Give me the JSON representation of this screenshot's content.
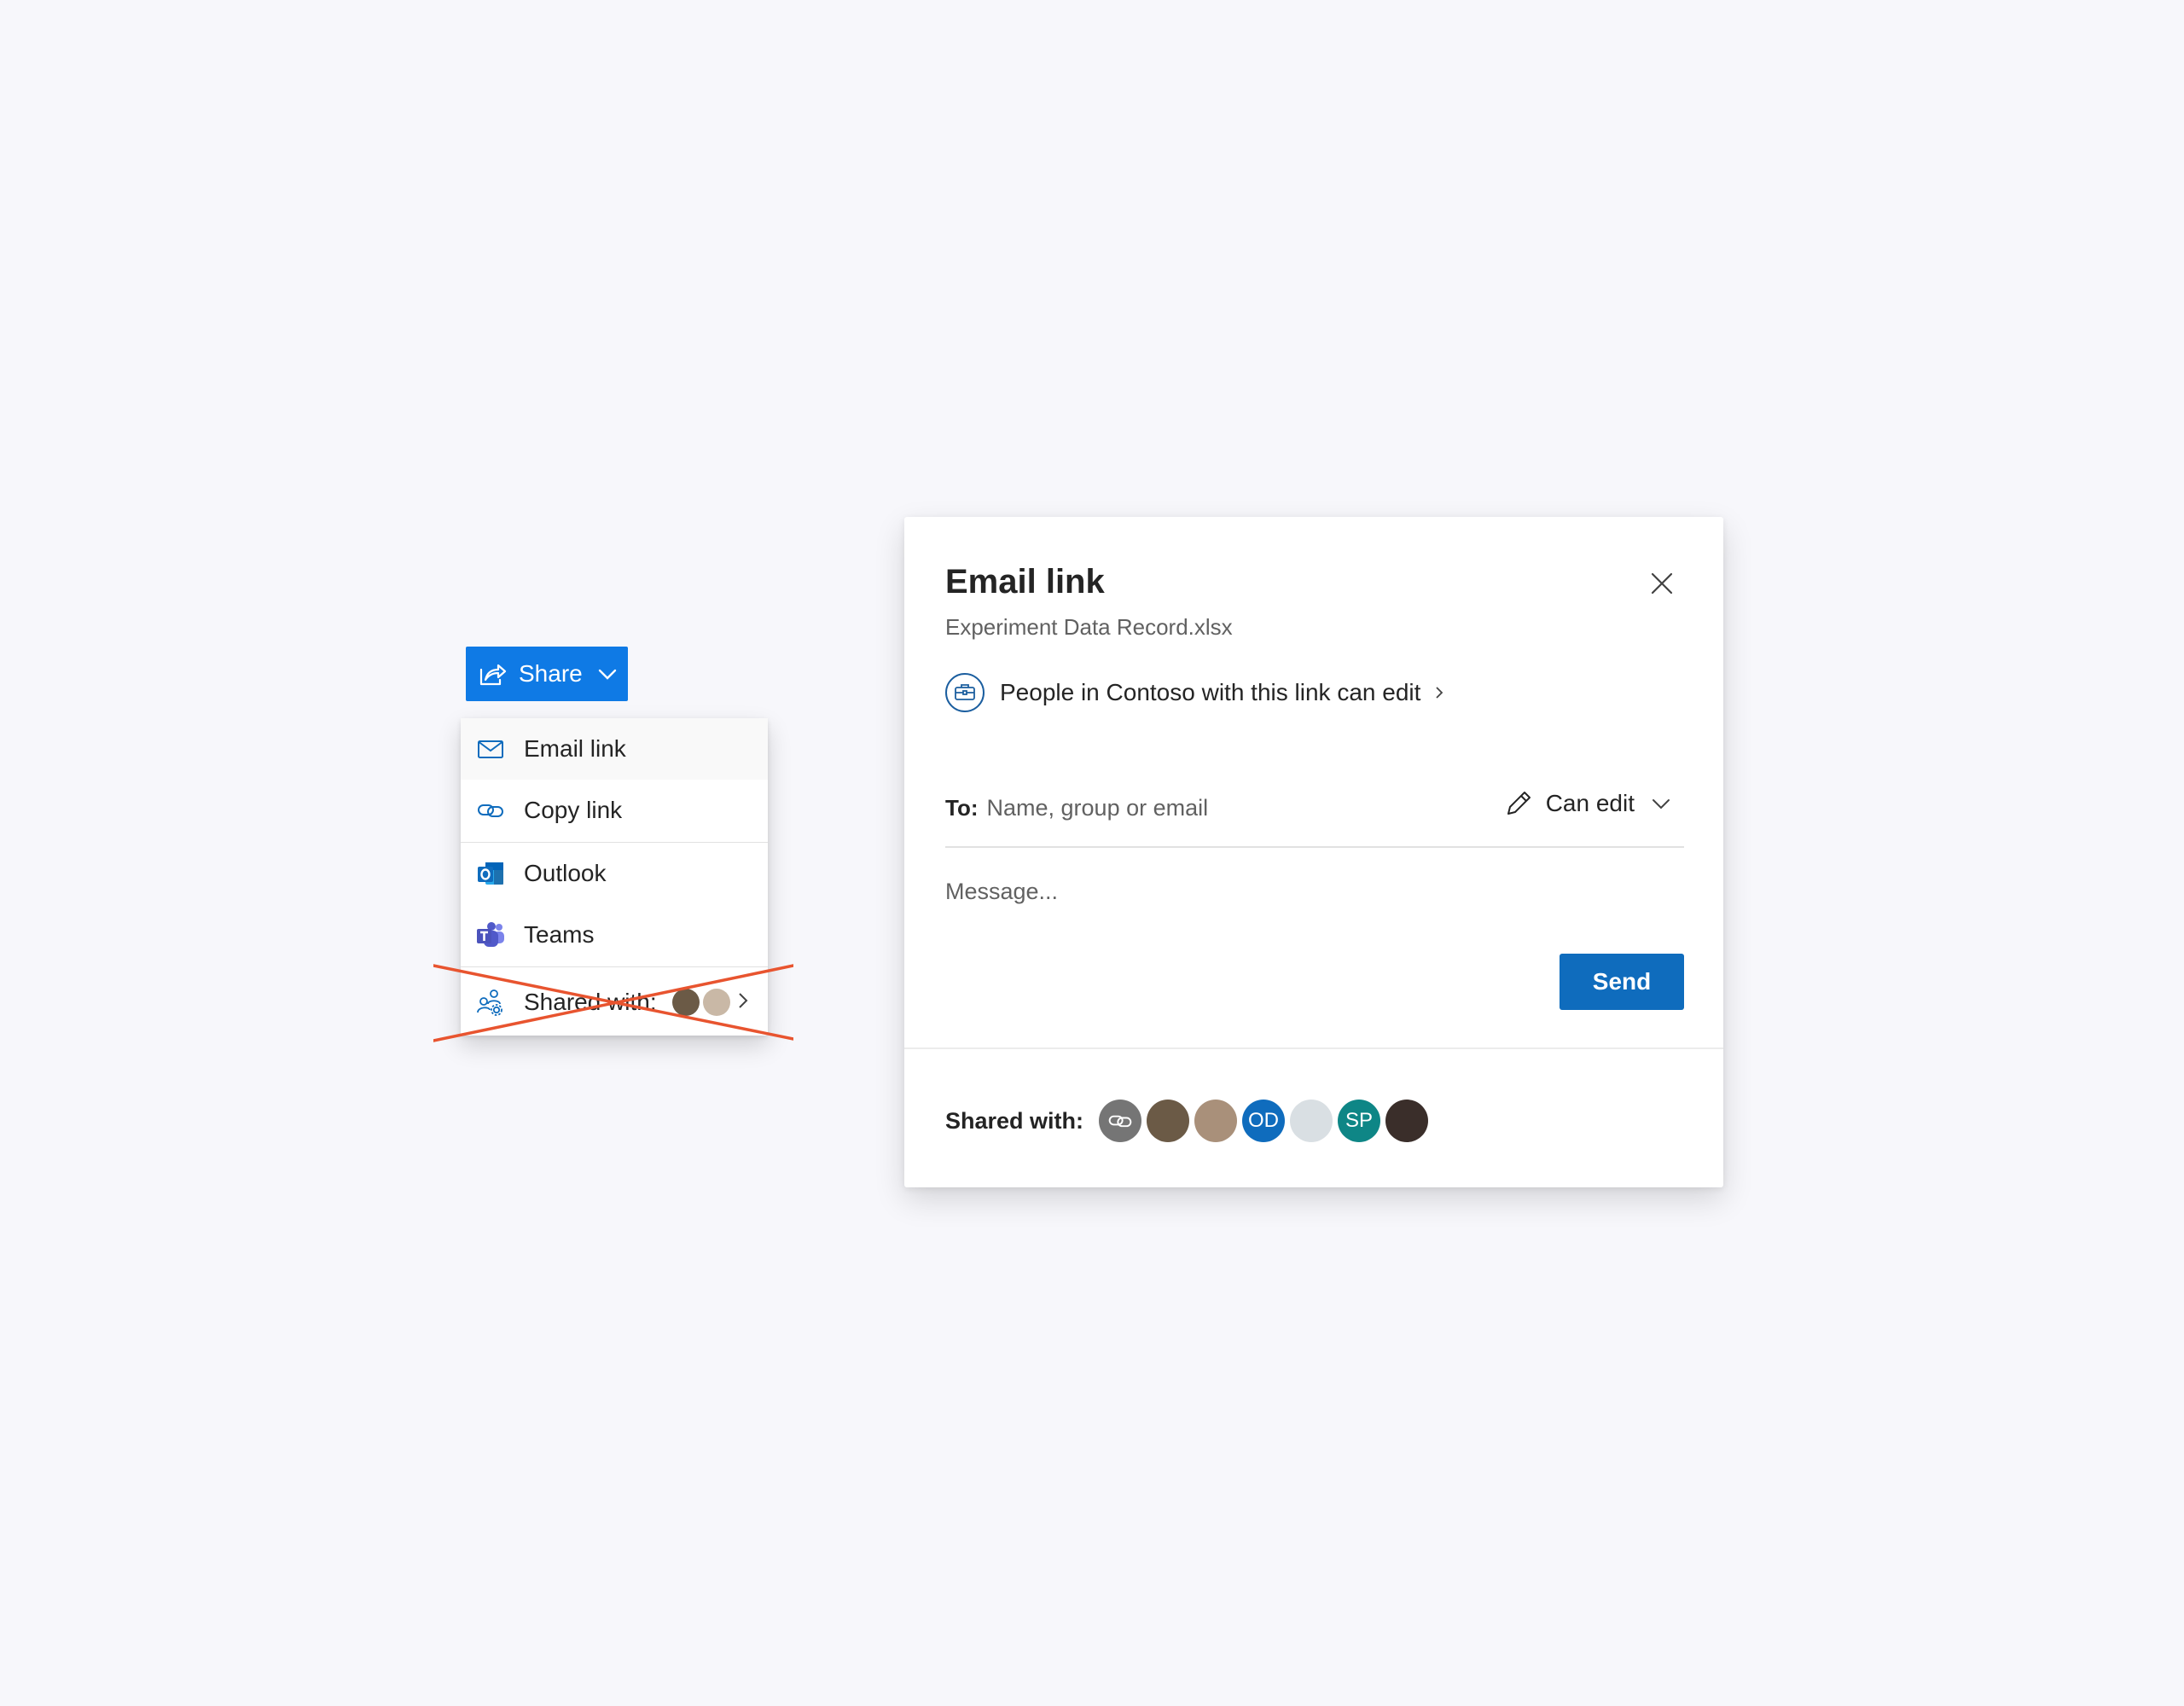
{
  "share_button": {
    "label": "Share",
    "icon": "share-icon",
    "color": "#0f7ae5"
  },
  "menu": {
    "items": [
      {
        "label": "Email link",
        "icon": "mail-icon"
      },
      {
        "label": "Copy link",
        "icon": "link-icon"
      },
      {
        "label": "Outlook",
        "icon": "outlook-icon"
      },
      {
        "label": "Teams",
        "icon": "teams-icon"
      }
    ],
    "shared_with": {
      "label": "Shared with:",
      "icon": "people-settings-icon",
      "crossed_out": true,
      "cross_color": "#e8542f"
    }
  },
  "dialog": {
    "title": "Email link",
    "file_name": "Experiment Data Record.xlsx",
    "permission": "People in Contoso with this link can edit",
    "to_label": "To:",
    "to_placeholder": "Name, group or email",
    "access": "Can edit",
    "message_placeholder": "Message...",
    "send_label": "Send",
    "shared_with_label": "Shared with:",
    "shared_with": [
      {
        "type": "link-icon",
        "color": "#757575"
      },
      {
        "type": "photo",
        "color": "#6b5a46"
      },
      {
        "type": "photo",
        "color": "#a9907a"
      },
      {
        "initials": "OD",
        "color": "#0f6cbd"
      },
      {
        "type": "photo",
        "color": "#d9dfe3"
      },
      {
        "initials": "SP",
        "color": "#0e8686"
      },
      {
        "type": "photo",
        "color": "#3a2e2a"
      }
    ]
  }
}
